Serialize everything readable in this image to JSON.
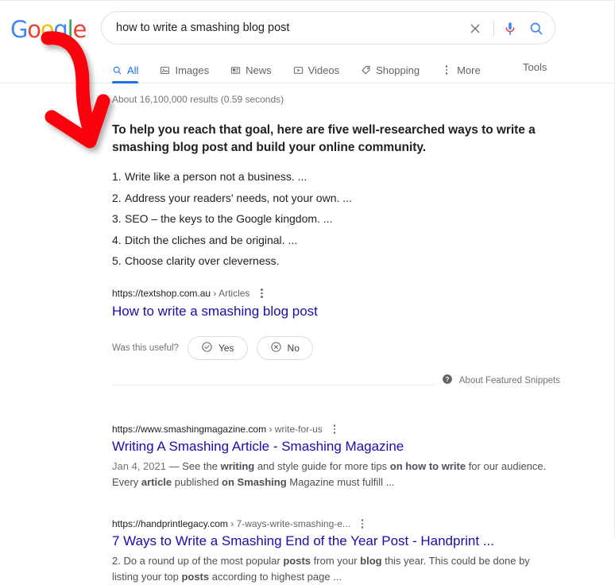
{
  "brand": {
    "logo_letters": [
      {
        "char": "G",
        "color": "#4285F4"
      },
      {
        "char": "o",
        "color": "#EA4335"
      },
      {
        "char": "o",
        "color": "#FBBC05"
      },
      {
        "char": "g",
        "color": "#4285F4"
      },
      {
        "char": "l",
        "color": "#34A853"
      },
      {
        "char": "e",
        "color": "#EA4335"
      }
    ],
    "logo_text": "Google"
  },
  "search": {
    "value": "how to write a smashing blog post",
    "placeholder": "Search",
    "clear_label": "Clear",
    "mic_label": "Search by voice",
    "search_label": "Google Search"
  },
  "nav": {
    "tabs": [
      {
        "label": "All",
        "icon": "magnifier-icon",
        "active": true
      },
      {
        "label": "Images",
        "icon": "image-icon",
        "active": false
      },
      {
        "label": "News",
        "icon": "news-icon",
        "active": false
      },
      {
        "label": "Videos",
        "icon": "video-icon",
        "active": false
      },
      {
        "label": "Shopping",
        "icon": "tag-icon",
        "active": false
      },
      {
        "label": "More",
        "icon": "kebab-icon",
        "active": false
      }
    ],
    "tools_label": "Tools"
  },
  "results_count": "About 16,100,000 results (0.59 seconds)",
  "featured_snippet": {
    "heading": "To help you reach that goal, here are five well-researched ways to write a smashing blog post and build your online community.",
    "items": [
      "Write like a person not a business. ...",
      "Address your readers' needs, not your own. ...",
      "SEO – the keys to the Google kingdom. ...",
      "Ditch the cliches and be original. ...",
      "Choose clarity over cleverness."
    ],
    "cite_domain": "https://textshop.com.au",
    "cite_sep": "›",
    "cite_path": "Articles",
    "title": "How to write a smashing blog post",
    "feedback_label": "Was this useful?",
    "yes_label": "Yes",
    "no_label": "No",
    "about_label": "About Featured Snippets"
  },
  "results": [
    {
      "cite_domain": "https://www.smashingmagazine.com",
      "cite_sep": "›",
      "cite_path": "write-for-us",
      "title": "Writing A Smashing Article - Smashing Magazine",
      "date": "Jan 4, 2021",
      "desc_line1_pre": " — See the ",
      "desc_b1": "writing",
      "desc_mid1": " and style guide for more tips ",
      "desc_b2": "on how to write",
      "desc_mid2": " for our audience. Every ",
      "desc_b3": "article",
      "desc_mid3": " published ",
      "desc_b4": "on Smashing",
      "desc_tail": " Magazine must fulfill ..."
    },
    {
      "cite_domain": "https://handprintlegacy.com",
      "cite_sep": "›",
      "cite_path": "7-ways-write-smashing-e...",
      "title": "7 Ways to Write a Smashing End of the Year Post - Handprint ...",
      "date": "",
      "desc_line1_pre": "2. Do a round up of the most popular ",
      "desc_b1": "posts",
      "desc_mid1": " from your ",
      "desc_b2": "blog",
      "desc_mid2": " this year. This could be done by listing your top ",
      "desc_b3": "posts",
      "desc_mid3": " according to highest page ...",
      "desc_b4": "",
      "desc_tail": ""
    }
  ],
  "annotation": {
    "type": "hand-drawn-arrow",
    "color": "#FB0007",
    "points_to": "featured-snippet"
  },
  "colors": {
    "link": "#1a0dab",
    "accent": "#1a73e8",
    "muted": "#70757a",
    "text": "#202124"
  }
}
